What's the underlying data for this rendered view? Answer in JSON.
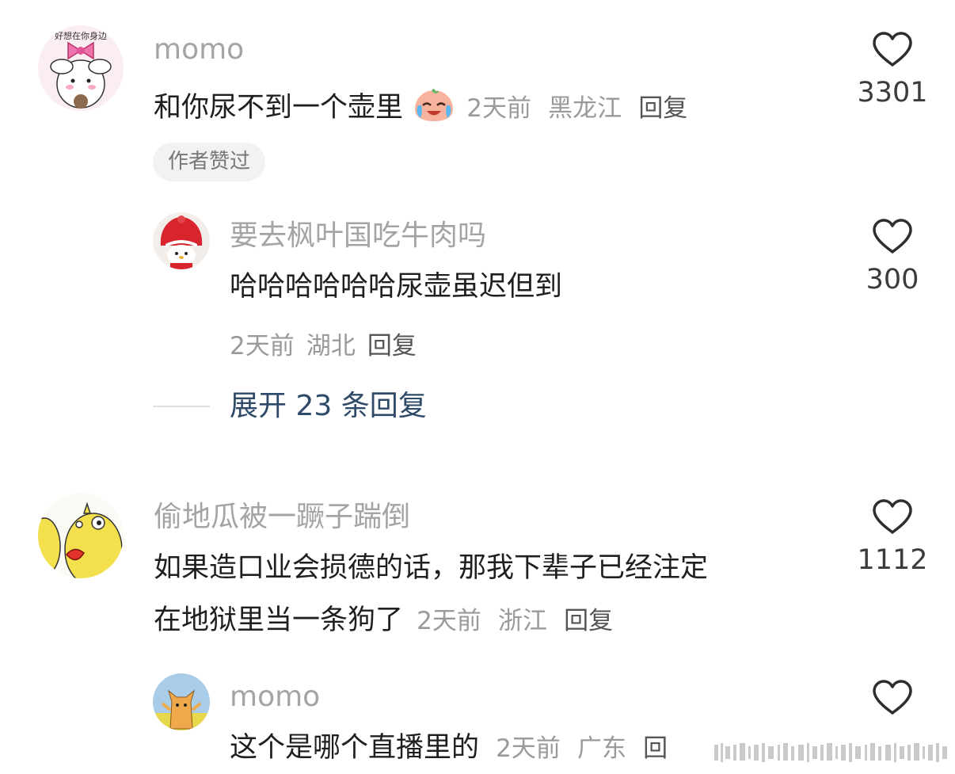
{
  "comments": [
    {
      "username": "momo",
      "avatar_text": "好想在你身边",
      "text": "和你尿不到一个壶里",
      "emoji": "crying-laughing-peach",
      "time": "2天前",
      "location": "黑龙江",
      "reply_label": "回复",
      "likes": "3301",
      "tag": "作者赞过",
      "replies": [
        {
          "username": "要去枫叶国吃牛肉吗",
          "text": "哈哈哈哈哈哈尿壶虽迟但到",
          "time": "2天前",
          "location": "湖北",
          "reply_label": "回复",
          "likes": "300"
        }
      ],
      "expand_label": "展开 23 条回复"
    },
    {
      "username": "偷地瓜被一蹶子踹倒",
      "text_line1": "如果造口业会损德的话，那我下辈子已经注定",
      "text_line2": "在地狱里当一条狗了",
      "time": "2天前",
      "location": "浙江",
      "reply_label": "回复",
      "likes": "1112",
      "replies": [
        {
          "username": "momo",
          "text": "这个是哪个直播里的",
          "time": "2天前",
          "location": "广东",
          "reply_label": "回",
          "likes": ""
        }
      ]
    }
  ],
  "colors": {
    "text": "#1f1f1f",
    "username": "#a4a4a4",
    "meta": "#9a9a9a",
    "expand_link": "#2f4a69"
  }
}
